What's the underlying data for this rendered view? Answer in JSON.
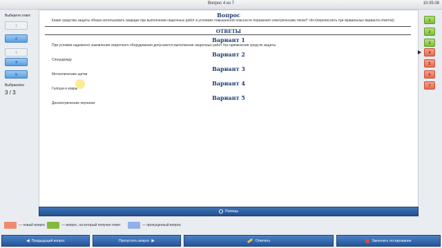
{
  "window": {
    "title": "Вопрос 4 из 7",
    "time": "10:35:08"
  },
  "left_panel": {
    "choose_label": "Выберите ответ:",
    "options": [
      {
        "label": "1",
        "state": "disabled"
      },
      {
        "label": "2",
        "state": "active"
      },
      {
        "label": "3",
        "state": "disabled"
      },
      {
        "label": "4",
        "state": "active"
      },
      {
        "label": "5",
        "state": "active"
      }
    ],
    "selected_label": "Выбрано/из:",
    "selected_value": "3 / 3"
  },
  "question": {
    "heading": "Вопрос",
    "text": "Какие средства защиты обязан использовать сварщик при выполнении сварочных работ в условиях повышенной опасности поражения электрическим током? <br>(перечислить три правильных варианта ответов)"
  },
  "answers": {
    "heading": "ОТВЕТЫ",
    "variants": [
      {
        "title": "Вариант 1",
        "text": "При условии надежного заземления сварочного оборудования допускается выполнение сварочных работ без применения средств защиты"
      },
      {
        "title": "Вариант 2",
        "text": "Спецодежду"
      },
      {
        "title": "Вариант 3",
        "text": "Металлические щетки"
      },
      {
        "title": "Вариант 4",
        "text": "Галоши и ковры"
      },
      {
        "title": "Вариант 5",
        "text": "Диэлектрические перчатки"
      }
    ]
  },
  "help_label": "Помощь",
  "question_nav": [
    {
      "label": "1",
      "status": "answered"
    },
    {
      "label": "2",
      "status": "answered"
    },
    {
      "label": "3",
      "status": "answered"
    },
    {
      "label": "4",
      "status": "new"
    },
    {
      "label": "5",
      "status": "new"
    },
    {
      "label": "6",
      "status": "new"
    },
    {
      "label": "7",
      "status": "new"
    }
  ],
  "legend": [
    {
      "color": "#f08a6e",
      "text": "— новый вопрос"
    },
    {
      "color": "#82b93d",
      "text": "— вопрос, на который получен ответ"
    },
    {
      "color": "#8fb0e8",
      "text": "— пропущенный вопрос"
    }
  ],
  "toolbar": {
    "prev": "Предыдущий вопрос",
    "skip": "Пропустить вопрос",
    "answer": "Ответить",
    "finish": "Закончить тестирование"
  },
  "colors": {
    "accent": "#2f5fa3",
    "heading": "#1f3f72"
  }
}
